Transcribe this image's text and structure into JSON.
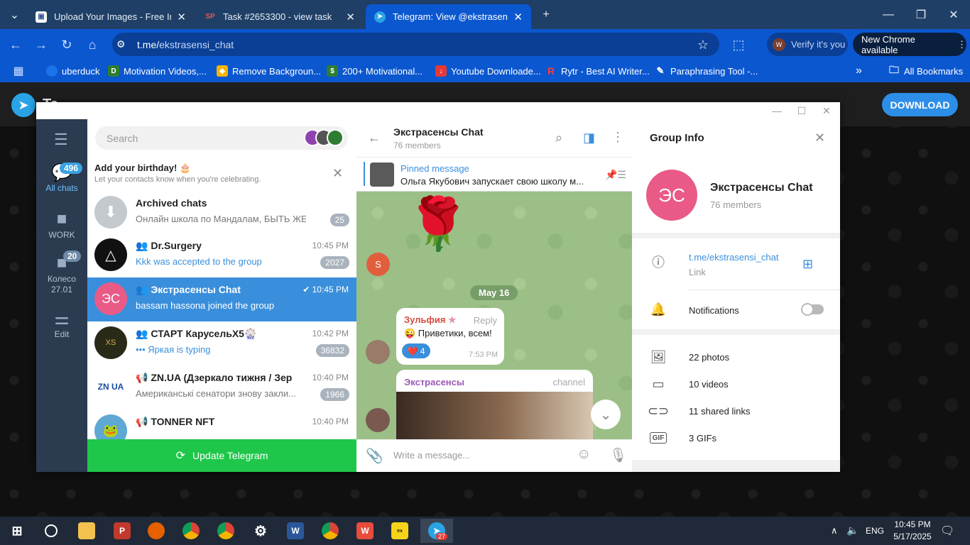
{
  "browser": {
    "tabs": [
      {
        "title": "Upload Your Images - Free Image",
        "fav_color": "#3b5998"
      },
      {
        "title": "Task #2653300 - view task",
        "fav_text": "SP",
        "fav_color": "#c0392b"
      },
      {
        "title": "Telegram: View @ekstrasensi_chat",
        "fav_color": "#2aa3e6"
      }
    ],
    "url_host": "t.me/",
    "url_path": "ekstrasensi_chat",
    "verify_label": "Verify it's you",
    "verify_initial": "W",
    "new_chrome": "New Chrome available",
    "bookmarks": [
      {
        "label": "uberduck",
        "color": "#1a73e8"
      },
      {
        "label": "Motivation Videos,...",
        "color": "#2e7d32"
      },
      {
        "label": "Remove Backgroun...",
        "color": "#f4b400"
      },
      {
        "label": "200+ Motivational...",
        "color": "#2e7d32"
      },
      {
        "label": "Youtube Downloade...",
        "color": "#e53935"
      },
      {
        "label": "Rytr - Best AI Writer...",
        "color": "#e53935"
      },
      {
        "label": "Paraphrasing Tool -...",
        "color": "#555555"
      }
    ],
    "all_bookmarks": "All Bookmarks"
  },
  "web": {
    "logo_text": "Te",
    "download": "DOWNLOAD"
  },
  "rail": {
    "all_chats": {
      "label": "All chats",
      "badge": "496"
    },
    "work": {
      "label": "WORK"
    },
    "koleso": {
      "label": "Колесо 27.01",
      "badge": "20"
    },
    "edit": {
      "label": "Edit"
    }
  },
  "chatlist": {
    "search_placeholder": "Search",
    "bday_title": "Add your birthday! 🎂",
    "bday_sub": "Let your contacts know when you're celebrating.",
    "chats": [
      {
        "name": "Archived chats",
        "time": "",
        "msg": "Онлайн школа по Мандалам, БЫТЬ ЖЕ...",
        "count": "25",
        "avatar": "",
        "color": "#c4c9ce"
      },
      {
        "name": "Dr.Surgery",
        "time": "10:45 PM",
        "msg": "Kkk was accepted to the group",
        "count": "2027",
        "avatar": "",
        "color": "#111111"
      },
      {
        "name": "Экстрасенсы Chat",
        "time": "10:45 PM",
        "msg": "bassam hassona joined the group",
        "count": "",
        "avatar": "ЭС",
        "color": "#ea5a86"
      },
      {
        "name": "СТАРТ КарусельX5🎡",
        "time": "10:42 PM",
        "msg": "••• Яркая is typing",
        "count": "36832",
        "avatar": "",
        "color": "#2a2a18"
      },
      {
        "name": "ZN.UA (Дзеркало тижня / Зеркал...",
        "time": "10:40 PM",
        "msg": "Американські сенатори знову закли...",
        "count": "1966",
        "avatar": "ZN UA",
        "color": "#ffffff"
      },
      {
        "name": "TONNER NFT",
        "time": "10:40 PM",
        "msg": "",
        "count": "",
        "avatar": "",
        "color": "#5fa8d3"
      }
    ],
    "update": "Update Telegram"
  },
  "conversation": {
    "title": "Экстрасенсы Chat",
    "members": "76 members",
    "pinned_title": "Pinned message",
    "pinned_text": "Ольга Якубович запускает свою школу м...",
    "sticker_sender_initial": "S",
    "date": "May 16",
    "msg1": {
      "author": "Зульфия",
      "reply": "Reply",
      "text": "😜 Приветики, всем!",
      "reaction": "❤️",
      "reaction_count": "4",
      "time": "7:53 PM"
    },
    "msg2": {
      "author": "Экстрасенсы",
      "tag": "channel"
    },
    "composer_placeholder": "Write a message..."
  },
  "info": {
    "title": "Group Info",
    "avatar": "ЭС",
    "name": "Экстрасенсы Chat",
    "members": "76 members",
    "link": "t.me/ekstrasensi_chat",
    "link_label": "Link",
    "notifications": "Notifications",
    "media": [
      {
        "label": "22 photos",
        "icon": "photo-icon"
      },
      {
        "label": "10 videos",
        "icon": "video-icon"
      },
      {
        "label": "11 shared links",
        "icon": "link-icon"
      },
      {
        "label": "3 GIFs",
        "icon": "gif-icon"
      }
    ]
  },
  "taskbar": {
    "time": "10:45 PM",
    "date": "5/17/2025",
    "lang": "ENG",
    "tg_badge": "27"
  }
}
